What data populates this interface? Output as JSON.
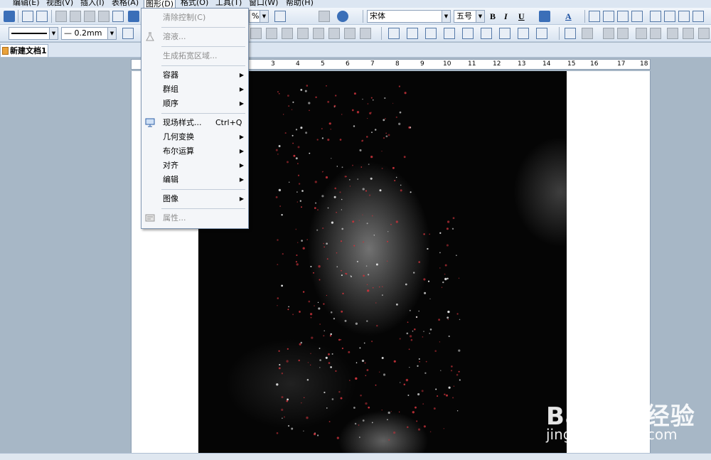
{
  "menubar": {
    "items": [
      {
        "key": "edit",
        "label": "编辑(E)"
      },
      {
        "key": "view",
        "label": "视图(V)"
      },
      {
        "key": "insert",
        "label": "插入(I)"
      },
      {
        "key": "table",
        "label": "表格(A)"
      },
      {
        "key": "graphics",
        "label": "图形(D)",
        "active": true
      },
      {
        "key": "format",
        "label": "格式(O)"
      },
      {
        "key": "tools",
        "label": "工具(T)"
      },
      {
        "key": "window",
        "label": "窗口(W)"
      },
      {
        "key": "help",
        "label": "帮助(H)"
      }
    ]
  },
  "toolbar": {
    "zoom_value": "%",
    "font_name": "宋体",
    "font_size": "五号",
    "bold": "B",
    "italic": "I",
    "underline": "U",
    "line_width": "— 0.2mm",
    "font_color_glyph": "A"
  },
  "document_tab": {
    "label": "新建文档1"
  },
  "ruler": {
    "labels": [
      "3",
      "4",
      "5",
      "6",
      "7",
      "8",
      "9",
      "10",
      "11",
      "12",
      "13",
      "14",
      "15",
      "16",
      "17",
      "18"
    ]
  },
  "graphics_menu": {
    "items": [
      {
        "label": "清除控制(C)",
        "disabled": true
      },
      {
        "label": "溶液...",
        "disabled": true
      },
      {
        "label": "生成拓宽区域...",
        "disabled": true
      },
      {
        "label": "容器",
        "submenu": true
      },
      {
        "label": "群组",
        "submenu": true
      },
      {
        "label": "顺序",
        "submenu": true
      },
      {
        "label": "现场样式...",
        "shortcut": "Ctrl+Q"
      },
      {
        "label": "几何变换",
        "submenu": true
      },
      {
        "label": "布尔运算",
        "submenu": true
      },
      {
        "label": "对齐",
        "submenu": true
      },
      {
        "label": "编辑",
        "submenu": true
      },
      {
        "label": "图像",
        "submenu": true
      },
      {
        "label": "属性...",
        "disabled": true
      }
    ]
  },
  "watermark": {
    "brand": "Bai du 经验",
    "url": "jingyan.baidu.com"
  },
  "colors": {
    "menu_bg": "#dce6f2",
    "workspace_bg": "#a7b7c6",
    "dropdown_bg": "#f4f6f9"
  }
}
